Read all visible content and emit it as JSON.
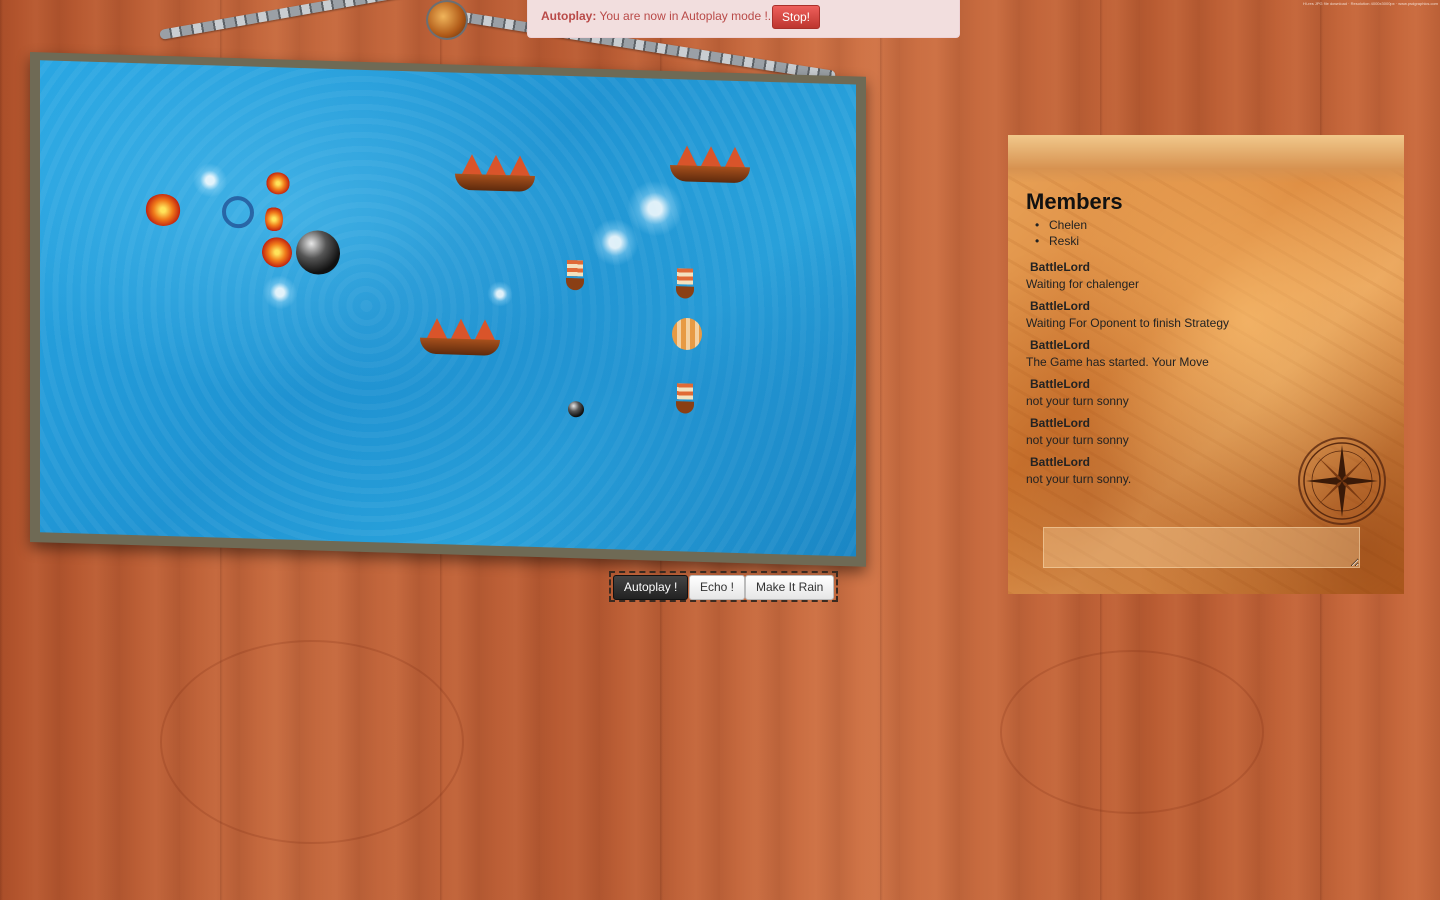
{
  "alert": {
    "title": "Autoplay:",
    "message": "You are now in Autoplay mode !.",
    "stop_label": "Stop!"
  },
  "controls": {
    "autoplay_label": "Autoplay !",
    "echo_label": "Echo !",
    "rain_label": "Make It Rain"
  },
  "members": {
    "title": "Members",
    "list": [
      "Chelen",
      "Reski"
    ]
  },
  "messages": [
    {
      "author": "BattleLord",
      "text": "Waiting for chalenger"
    },
    {
      "author": "BattleLord",
      "text": "Waiting For Oponent to finish Strategy"
    },
    {
      "author": "BattleLord",
      "text": "The Game has started. Your Move"
    },
    {
      "author": "BattleLord",
      "text": "not your turn sonny"
    },
    {
      "author": "BattleLord",
      "text": "not your turn sonny"
    },
    {
      "author": "BattleLord",
      "text": "not your turn sonny."
    }
  ],
  "watermark": "Hi-res JPG file download · Resolution 4000x3000px · www.psdgraphics.com",
  "colors": {
    "alert_bg": "#f2dede",
    "alert_text": "#b94a48",
    "stop_button": "#da4f49",
    "sea": "#1f93d2",
    "wood": "#c0623a",
    "parchment": "#e09a4e"
  }
}
